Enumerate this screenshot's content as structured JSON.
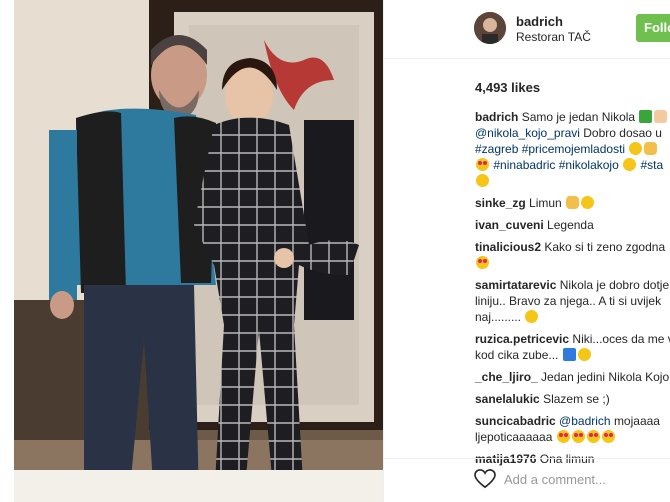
{
  "post": {
    "username": "badrich",
    "location": "Restoran TAČ",
    "follow_label": "Follow",
    "likes": "4,493 likes"
  },
  "comments": [
    {
      "user": "badrich",
      "text": "Samo je jedan Nikola"
    },
    {
      "user": "",
      "text_link": "@nikola_kojo_pravi",
      "text": "Dobro dosao u"
    },
    {
      "user": "",
      "text_link": "#zagreb #pricemojemladosti",
      "text": ""
    },
    {
      "user": "",
      "text_link": "#ninabadric #nikolakojo",
      "text": "#sta"
    },
    {
      "user": "",
      "text": ""
    },
    {
      "user": "sinke_zg",
      "text": "Limun"
    },
    {
      "user": "ivan_cuveni",
      "text": "Legenda"
    },
    {
      "user": "tinalicious2",
      "text": "Kako si ti zeno zgodna"
    },
    {
      "user": "",
      "text": ""
    },
    {
      "user": "samirtatarevic",
      "text": "Nikola je dobro dotje"
    },
    {
      "user": "",
      "text": "liniju.. Bravo za njega.. A ti si uvijek"
    },
    {
      "user": "",
      "text": "naj........."
    },
    {
      "user": "ruzica.petricevic",
      "text": "Niki...oces da me v"
    },
    {
      "user": "",
      "text": "kod cika zube..."
    },
    {
      "user": "_che_ljiro_",
      "text": "Jedan jedini Nikola Kojo"
    },
    {
      "user": "sanelalukic",
      "text": "Slazem se ;)"
    },
    {
      "user": "suncicabadric",
      "text_link": "@badrich",
      "text": "mojaaaa"
    },
    {
      "user": "",
      "text": "ljepoticaaaaaa"
    },
    {
      "user": "matija1976",
      "text": "Ona limun"
    }
  ],
  "footer": {
    "add_comment_placeholder": "Add a comment..."
  },
  "icons": {
    "like": "heart-icon"
  },
  "colors": {
    "follow": "#70c050",
    "link": "#003569"
  }
}
